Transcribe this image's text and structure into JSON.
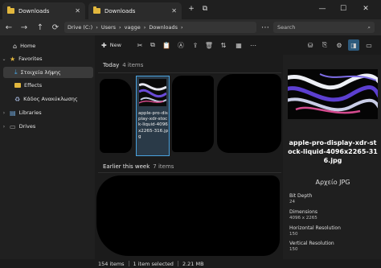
{
  "window": {
    "tabs": [
      {
        "label": "Downloads"
      },
      {
        "label": "Downloads"
      }
    ]
  },
  "address_bar": {
    "crumbs": [
      "Drive (C:)",
      "Users",
      "vagge",
      "Downloads"
    ],
    "search_placeholder": "Search"
  },
  "sidebar": {
    "items": [
      {
        "label": "Home",
        "icon": "home-icon"
      },
      {
        "label": "Favorites",
        "icon": "star-icon"
      },
      {
        "label": "Στοιχεία λήψης",
        "icon": "download-icon"
      },
      {
        "label": "Effects",
        "icon": "folder-icon"
      },
      {
        "label": "Κάδος Ανακύκλωσης",
        "icon": "recycle-bin-icon"
      },
      {
        "label": "Libraries",
        "icon": "library-icon"
      },
      {
        "label": "Drives",
        "icon": "drive-icon"
      }
    ]
  },
  "toolbar": {
    "new_label": "New"
  },
  "main": {
    "groups": [
      {
        "title": "Today",
        "count": "4 items"
      },
      {
        "title": "Earlier this week",
        "count": "7 items"
      }
    ],
    "selected_file_name": "apple-pro-display-xdr-stock-liquid-4096x2265-316.jpg"
  },
  "details": {
    "title": "apple-pro-display-xdr-stock-liquid-4096x2265-316.jpg",
    "type": "Αρχείο JPG",
    "properties": [
      {
        "label": "Bit Depth",
        "value": "24"
      },
      {
        "label": "Dimensions",
        "value": "4096 x 2265"
      },
      {
        "label": "Horizontal Resolution",
        "value": "150"
      },
      {
        "label": "Vertical Resolution",
        "value": "150"
      }
    ]
  },
  "status": {
    "items_count": "154 items",
    "selection": "1 item selected",
    "size": "2.21 MB"
  },
  "colors": {
    "accent": "#4aa3df",
    "folder": "#e2b73d",
    "background": "#1b1b1b"
  }
}
